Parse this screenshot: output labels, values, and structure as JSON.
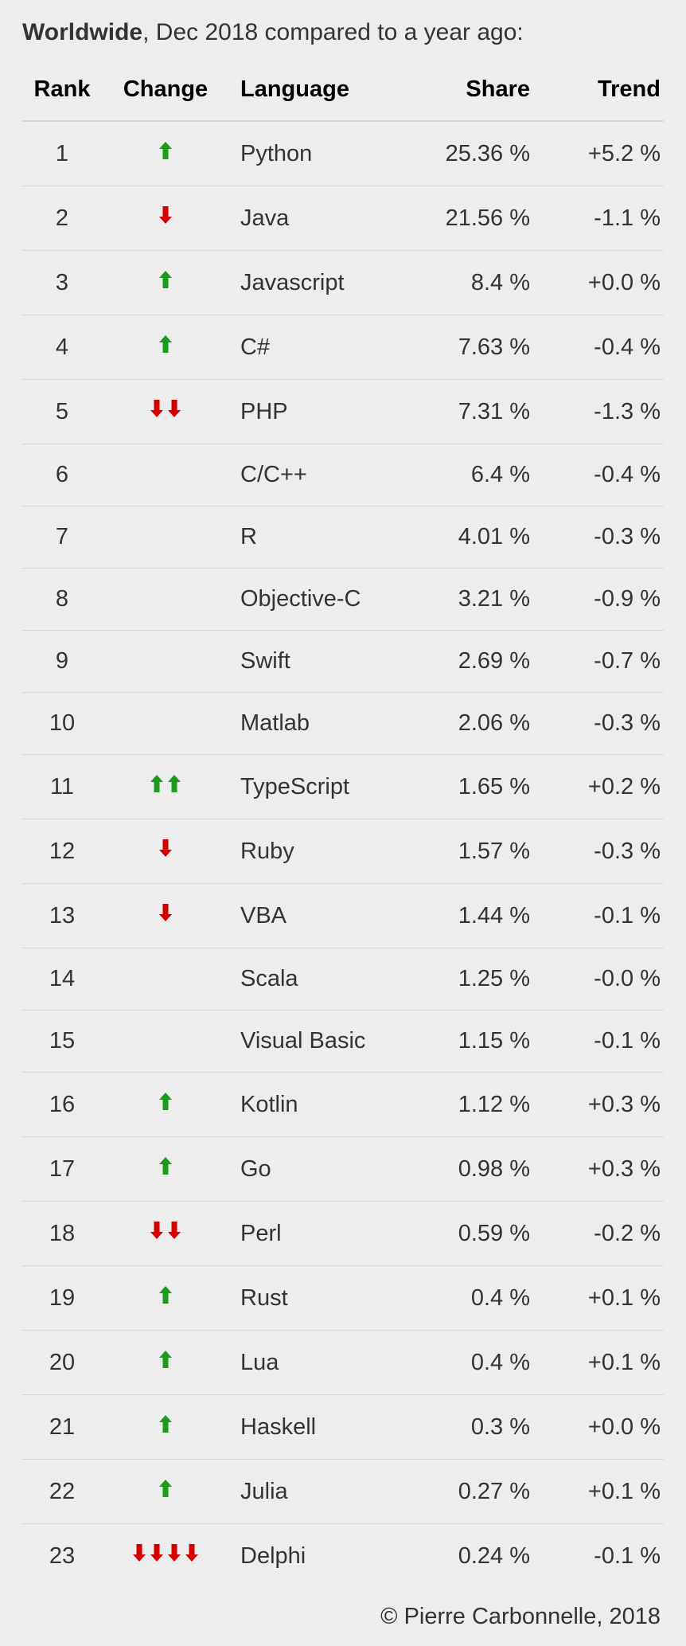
{
  "title_bold": "Worldwide",
  "title_rest": ", Dec 2018 compared to a year ago:",
  "columns": {
    "rank": "Rank",
    "change": "Change",
    "language": "Language",
    "share": "Share",
    "trend": "Trend"
  },
  "colors": {
    "up": "#1a9c1a",
    "down": "#d40000"
  },
  "chart_data": {
    "type": "table",
    "title": "Worldwide, Dec 2018 compared to a year ago",
    "columns": [
      "Rank",
      "Change",
      "Language",
      "Share",
      "Trend"
    ],
    "rows": [
      {
        "rank": 1,
        "change": 1,
        "language": "Python",
        "share": "25.36 %",
        "trend": "+5.2 %"
      },
      {
        "rank": 2,
        "change": -1,
        "language": "Java",
        "share": "21.56 %",
        "trend": "-1.1 %"
      },
      {
        "rank": 3,
        "change": 1,
        "language": "Javascript",
        "share": "8.4 %",
        "trend": "+0.0 %"
      },
      {
        "rank": 4,
        "change": 1,
        "language": "C#",
        "share": "7.63 %",
        "trend": "-0.4 %"
      },
      {
        "rank": 5,
        "change": -2,
        "language": "PHP",
        "share": "7.31 %",
        "trend": "-1.3 %"
      },
      {
        "rank": 6,
        "change": 0,
        "language": "C/C++",
        "share": "6.4 %",
        "trend": "-0.4 %"
      },
      {
        "rank": 7,
        "change": 0,
        "language": "R",
        "share": "4.01 %",
        "trend": "-0.3 %"
      },
      {
        "rank": 8,
        "change": 0,
        "language": "Objective-C",
        "share": "3.21 %",
        "trend": "-0.9 %"
      },
      {
        "rank": 9,
        "change": 0,
        "language": "Swift",
        "share": "2.69 %",
        "trend": "-0.7 %"
      },
      {
        "rank": 10,
        "change": 0,
        "language": "Matlab",
        "share": "2.06 %",
        "trend": "-0.3 %"
      },
      {
        "rank": 11,
        "change": 2,
        "language": "TypeScript",
        "share": "1.65 %",
        "trend": "+0.2 %"
      },
      {
        "rank": 12,
        "change": -1,
        "language": "Ruby",
        "share": "1.57 %",
        "trend": "-0.3 %"
      },
      {
        "rank": 13,
        "change": -1,
        "language": "VBA",
        "share": "1.44 %",
        "trend": "-0.1 %"
      },
      {
        "rank": 14,
        "change": 0,
        "language": "Scala",
        "share": "1.25 %",
        "trend": "-0.0 %"
      },
      {
        "rank": 15,
        "change": 0,
        "language": "Visual Basic",
        "share": "1.15 %",
        "trend": "-0.1 %"
      },
      {
        "rank": 16,
        "change": 1,
        "language": "Kotlin",
        "share": "1.12 %",
        "trend": "+0.3 %"
      },
      {
        "rank": 17,
        "change": 1,
        "language": "Go",
        "share": "0.98 %",
        "trend": "+0.3 %"
      },
      {
        "rank": 18,
        "change": -2,
        "language": "Perl",
        "share": "0.59 %",
        "trend": "-0.2 %"
      },
      {
        "rank": 19,
        "change": 1,
        "language": "Rust",
        "share": "0.4 %",
        "trend": "+0.1 %"
      },
      {
        "rank": 20,
        "change": 1,
        "language": "Lua",
        "share": "0.4 %",
        "trend": "+0.1 %"
      },
      {
        "rank": 21,
        "change": 1,
        "language": "Haskell",
        "share": "0.3 %",
        "trend": "+0.0 %"
      },
      {
        "rank": 22,
        "change": 1,
        "language": "Julia",
        "share": "0.27 %",
        "trend": "+0.1 %"
      },
      {
        "rank": 23,
        "change": -4,
        "language": "Delphi",
        "share": "0.24 %",
        "trend": "-0.1 %"
      }
    ]
  },
  "credit": "© Pierre Carbonnelle, 2018"
}
